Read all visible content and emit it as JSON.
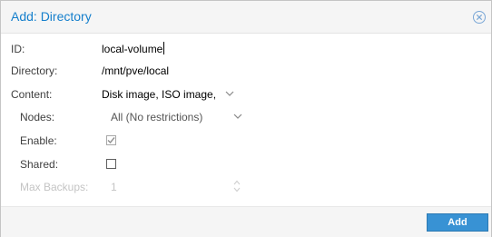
{
  "dialog": {
    "title": "Add: Directory",
    "close_icon": "close-circle-icon"
  },
  "form": {
    "id": {
      "label": "ID:",
      "value": "local-volume"
    },
    "directory": {
      "label": "Directory:",
      "value": "/mnt/pve/local"
    },
    "content": {
      "label": "Content:",
      "value": "Disk image, ISO image,",
      "icon": "chevron-down-icon"
    },
    "nodes": {
      "label": "Nodes:",
      "value": "All (No restrictions)",
      "icon": "chevron-down-icon"
    },
    "enable": {
      "label": "Enable:",
      "checked": true
    },
    "shared": {
      "label": "Shared:",
      "checked": false
    },
    "max_backups": {
      "label": "Max Backups:",
      "value": "1",
      "disabled": true,
      "icon": "spinner-updown-icon"
    }
  },
  "footer": {
    "add_label": "Add"
  },
  "colors": {
    "title": "#157fcc",
    "button_bg": "#3892d4",
    "header_bg": "#f5f5f5"
  }
}
